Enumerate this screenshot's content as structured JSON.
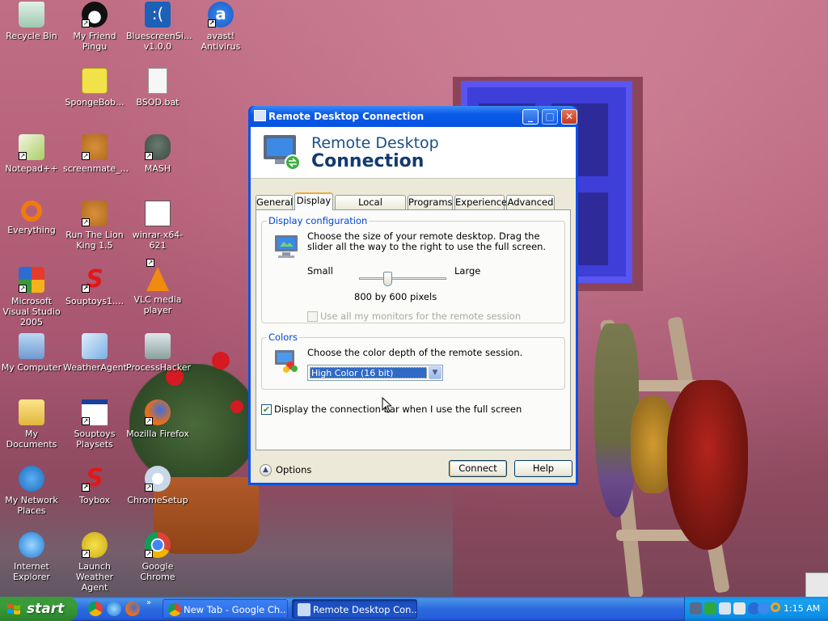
{
  "desktop": {
    "icons": [
      {
        "label": "Recycle Bin",
        "name": "recycle-bin-icon"
      },
      {
        "label": "My Friend Pingu",
        "name": "pingu-icon"
      },
      {
        "label": "BluescreenSi... v1.0.0",
        "name": "bluescreen-icon"
      },
      {
        "label": "avast! Antivirus",
        "name": "avast-icon"
      },
      {
        "label": "SpongeBob...",
        "name": "spongebob-icon"
      },
      {
        "label": "BSOD.bat",
        "name": "batch-file-icon"
      },
      {
        "label": "Notepad++",
        "name": "notepadpp-icon"
      },
      {
        "label": "screenmate_...",
        "name": "screenmate-icon"
      },
      {
        "label": "MASH",
        "name": "mash-icon"
      },
      {
        "label": "Everything",
        "name": "everything-icon"
      },
      {
        "label": "Run The Lion King 1.5",
        "name": "lion-king-icon"
      },
      {
        "label": "winrar-x64-621",
        "name": "winrar-icon"
      },
      {
        "label": "Microsoft Visual Studio 2005",
        "name": "visual-studio-icon"
      },
      {
        "label": "Souptoys1....",
        "name": "souptoys-icon"
      },
      {
        "label": "VLC media player",
        "name": "vlc-icon"
      },
      {
        "label": "My Computer",
        "name": "my-computer-icon"
      },
      {
        "label": "WeatherAgent",
        "name": "weatheragent-icon"
      },
      {
        "label": "ProcessHacker",
        "name": "processhacker-icon"
      },
      {
        "label": "My Documents",
        "name": "my-documents-icon"
      },
      {
        "label": "Souptoys Playsets",
        "name": "souptoys-playsets-icon"
      },
      {
        "label": "Mozilla Firefox",
        "name": "firefox-icon"
      },
      {
        "label": "My Network Places",
        "name": "network-places-icon"
      },
      {
        "label": "Toybox",
        "name": "toybox-icon"
      },
      {
        "label": "ChromeSetup",
        "name": "chromesetup-icon"
      },
      {
        "label": "Internet Explorer",
        "name": "internet-explorer-icon"
      },
      {
        "label": "Launch Weather Agent",
        "name": "launch-weather-agent-icon"
      },
      {
        "label": "Google Chrome",
        "name": "google-chrome-icon"
      }
    ]
  },
  "dialog": {
    "title": "Remote Desktop Connection",
    "banner_line1": "Remote Desktop",
    "banner_line2": "Connection",
    "tabs": [
      "General",
      "Display",
      "Local Resources",
      "Programs",
      "Experience",
      "Advanced"
    ],
    "active_tab": "Display",
    "display_config": {
      "legend": "Display configuration",
      "description": "Choose the size of your remote desktop. Drag the slider all the way to the right to use the full screen.",
      "slider_min_label": "Small",
      "slider_max_label": "Large",
      "slider_value_fraction": 0.33,
      "resolution": "800 by 600 pixels",
      "all_monitors_label": "Use all my monitors for the remote session",
      "all_monitors_checked": false,
      "all_monitors_enabled": false
    },
    "colors": {
      "legend": "Colors",
      "description": "Choose the color depth of the remote session.",
      "selected": "High Color (16 bit)"
    },
    "connection_bar_label": "Display the connection bar when I use the full screen",
    "connection_bar_checked": true,
    "options_label": "Options",
    "connect_label": "Connect",
    "help_label": "Help"
  },
  "taskbar": {
    "start_label": "start",
    "tasks": [
      {
        "label": "New Tab - Google Ch...",
        "name": "chrome-task",
        "active": false
      },
      {
        "label": "Remote Desktop Con...",
        "name": "rdc-task",
        "active": true
      }
    ],
    "quick_launch": [
      "chrome-icon",
      "ie-icon",
      "firefox-icon"
    ],
    "tray_icons": [
      "network-tray-icon",
      "weather-tray-icon",
      "usb-tray-icon",
      "volume-tray-icon",
      "info-tray-icon",
      "avast-tray-icon",
      "search-tray-icon"
    ],
    "clock": "1:15 AM"
  },
  "colors": {
    "title_bar": "#0a52e8",
    "taskbar": "#245edb",
    "start_button": "#389b38",
    "selection": "#316ac5"
  }
}
